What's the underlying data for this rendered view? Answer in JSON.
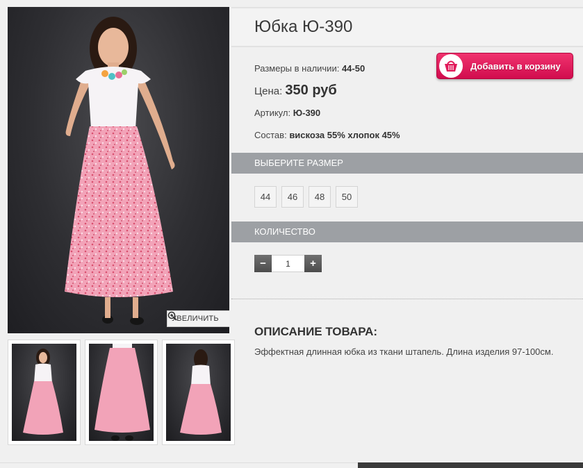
{
  "product": {
    "title": "Юбка Ю-390",
    "sizes_label": "Размеры в наличии:",
    "sizes_value": "44-50",
    "price_label": "Цена:",
    "price_value": "350 руб",
    "article_label": "Артикул:",
    "article_value": "Ю-390",
    "composition_label": "Состав:",
    "composition_value": "вискоза 55% хлопок 45%"
  },
  "gallery": {
    "zoom_label": "УВЕЛИЧИТЬ",
    "zoom_icon": "magnifier-plus-icon",
    "thumbnail_count": 3
  },
  "cart": {
    "label": "Добавить в корзину",
    "icon": "basket-icon",
    "color": "#e11a5a"
  },
  "size_section": {
    "header": "ВЫБЕРИТЕ РАЗМЕР",
    "options": [
      "44",
      "46",
      "48",
      "50"
    ]
  },
  "quantity_section": {
    "header": "КОЛИЧЕСТВО",
    "minus": "−",
    "plus": "+",
    "value": "1"
  },
  "description": {
    "title": "ОПИСАНИЕ ТОВАРА:",
    "text": "Эффектная длинная юбка из ткани штапель. Длина изделия 97-100см."
  },
  "colors": {
    "section_header_bg": "#9da0a4",
    "skirt_pink": "#ef9ab0",
    "background": "#f0f0f0"
  }
}
